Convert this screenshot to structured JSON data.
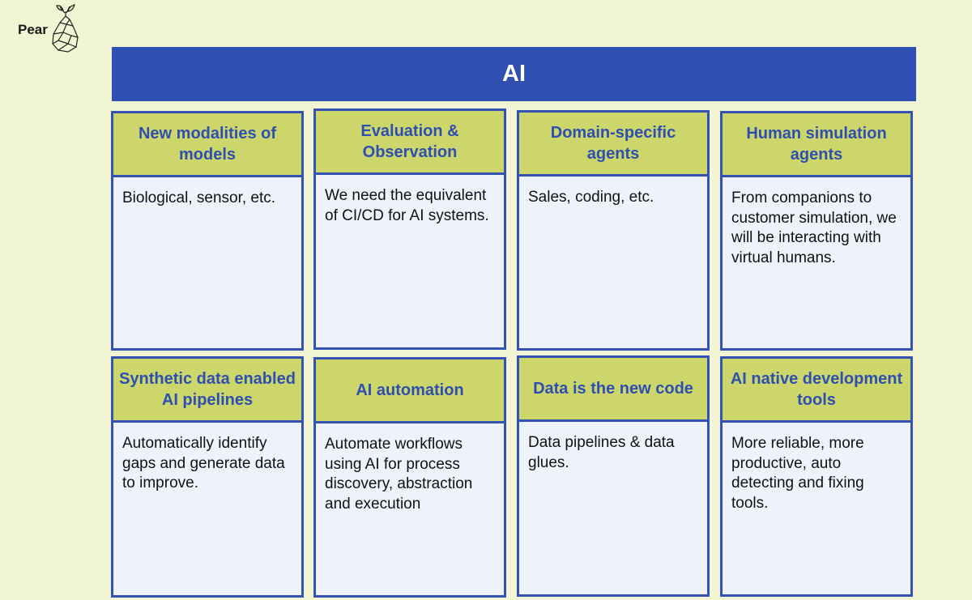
{
  "brand": {
    "name": "Pear",
    "logo_icon": "pear-icon"
  },
  "banner": {
    "title": "AI"
  },
  "cards": [
    {
      "title": "New modalities of models",
      "body": "Biological, sensor, etc."
    },
    {
      "title": "Evaluation & Observation",
      "body": "We need the equivalent of CI/CD for AI systems."
    },
    {
      "title": "Domain-specific agents",
      "body": "Sales, coding, etc."
    },
    {
      "title": "Human simulation agents",
      "body": "From companions to customer simulation, we will be interacting with virtual humans."
    },
    {
      "title": "Synthetic data enabled AI pipelines",
      "body": "Automatically identify gaps and generate data to improve."
    },
    {
      "title": "AI automation",
      "body": "Automate workflows using AI for process discovery, abstraction and execution"
    },
    {
      "title": "Data is the new code",
      "body": "Data pipelines & data glues."
    },
    {
      "title": "AI native development tools",
      "body": "More reliable, more productive, auto detecting and fixing tools."
    }
  ],
  "colors": {
    "background": "#f2f5d3",
    "banner": "#304fb3",
    "header": "#cdd66a",
    "title_text": "#2f4fb0",
    "card_body": "#eef3fb"
  }
}
